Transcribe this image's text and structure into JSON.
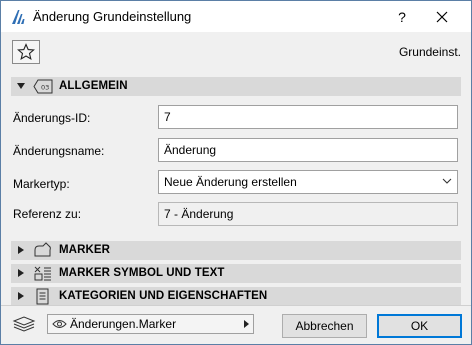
{
  "window": {
    "title": "Änderung Grundeinstellung",
    "help_label": "?",
    "preset_label": "Grundeinst."
  },
  "sections": {
    "general": {
      "title": "ALLGEMEIN",
      "badge": "03"
    },
    "marker": {
      "title": "MARKER"
    },
    "marker_symbol": {
      "title": "MARKER SYMBOL UND TEXT"
    },
    "categories": {
      "title": "KATEGORIEN UND EIGENSCHAFTEN"
    }
  },
  "fields": {
    "change_id": {
      "label": "Änderungs-ID:",
      "value": "7"
    },
    "change_name": {
      "label": "Änderungsname:",
      "value": "Änderung"
    },
    "marker_type": {
      "label": "Markertyp:",
      "value": "Neue Änderung erstellen"
    },
    "reference": {
      "label": "Referenz zu:",
      "value": "7 - Änderung"
    }
  },
  "footer": {
    "layer_value": "Änderungen.Marker",
    "cancel_label": "Abbrechen",
    "ok_label": "OK"
  },
  "colors": {
    "section_bg": "#d9d9d9",
    "ok_border": "#0078d7",
    "app_icon": "#2f6fb5"
  }
}
